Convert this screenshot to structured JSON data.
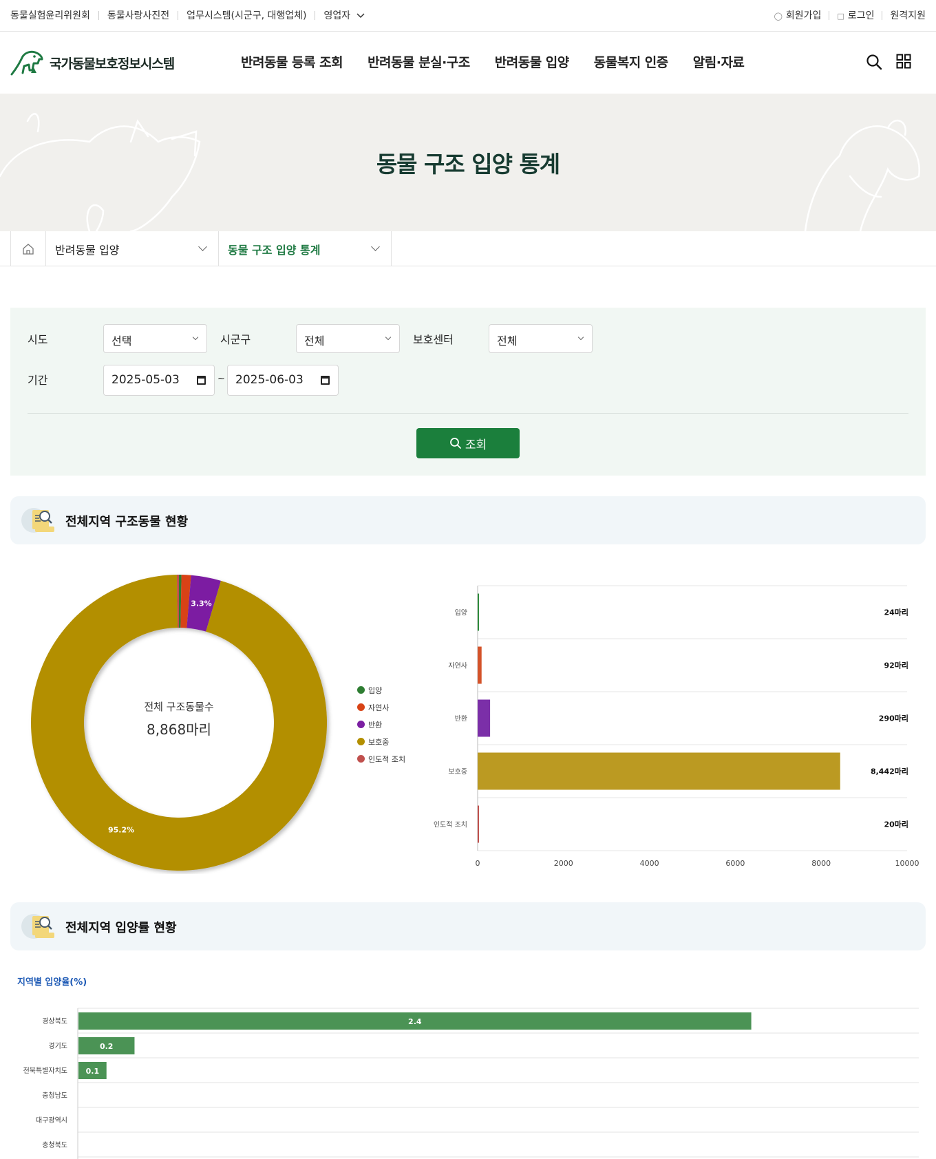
{
  "util_left": [
    "동물실험윤리위원회",
    "동물사랑사진전",
    "업무시스템(시군구, 대행업체)",
    "영업자"
  ],
  "util_right": {
    "signup": "회원가입",
    "login": "로그인",
    "remote": "원격지원"
  },
  "logo_text": "국가동물보호정보시스템",
  "gnb": [
    "반려동물 등록 조회",
    "반려동물 분실·구조",
    "반려동물 입양",
    "동물복지 인증",
    "알림·자료"
  ],
  "banner_title": "동물 구조 입양 통계",
  "breadcrumb": {
    "level1": "반려동물 입양",
    "level2": "동물 구조 입양 통계"
  },
  "search": {
    "sido_label": "시도",
    "sido_value": "선택",
    "sigungu_label": "시군구",
    "sigungu_value": "전체",
    "center_label": "보호센터",
    "center_value": "전체",
    "period_label": "기간",
    "date_from": "2025-05-03",
    "date_sep": "~",
    "date_to": "2025-06-03",
    "button": "조회"
  },
  "section1_title": "전체지역 구조동물 현황",
  "section2_title": "전체지역 입양률 현황",
  "donut_center": {
    "label": "전체 구조동물수",
    "value": "8,868마리"
  },
  "rate_title": "지역별 입양율(%)",
  "colors": {
    "brand": "#1b7f3c",
    "adopt": "#2e7d32",
    "natural_death": "#d84315",
    "return": "#7b1fa2",
    "protect": "#b38f00",
    "euthanasia": "#c0504d"
  },
  "chart_data": [
    {
      "type": "pie",
      "categories": [
        "입양",
        "자연사",
        "반환",
        "보호중",
        "인도적 조치"
      ],
      "values": [
        24,
        92,
        290,
        8442,
        20
      ],
      "slice_labels": [
        "",
        "",
        "3.3%",
        "95.2%",
        ""
      ],
      "legend": "right"
    },
    {
      "type": "bar",
      "orientation": "horizontal",
      "categories": [
        "입양",
        "자연사",
        "반환",
        "보호중",
        "인도적 조치"
      ],
      "values": [
        24,
        92,
        290,
        8442,
        20
      ],
      "value_labels": [
        "24마리",
        "92마리",
        "290마리",
        "8,442마리",
        "20마리"
      ],
      "xlim": [
        0,
        10000
      ],
      "xticks": [
        "0",
        "2000",
        "4000",
        "6000",
        "8000",
        "10000"
      ]
    },
    {
      "type": "bar",
      "orientation": "horizontal",
      "title": "지역별 입양율(%)",
      "categories": [
        "경상북도",
        "경기도",
        "전북특별자치도",
        "충청남도",
        "대구광역시",
        "충청북도"
      ],
      "values": [
        2.4,
        0.2,
        0.1,
        0,
        0,
        0
      ],
      "value_labels": [
        "2.4",
        "0.2",
        "0.1",
        "",
        "",
        ""
      ],
      "xlim": [
        0,
        3
      ]
    }
  ]
}
